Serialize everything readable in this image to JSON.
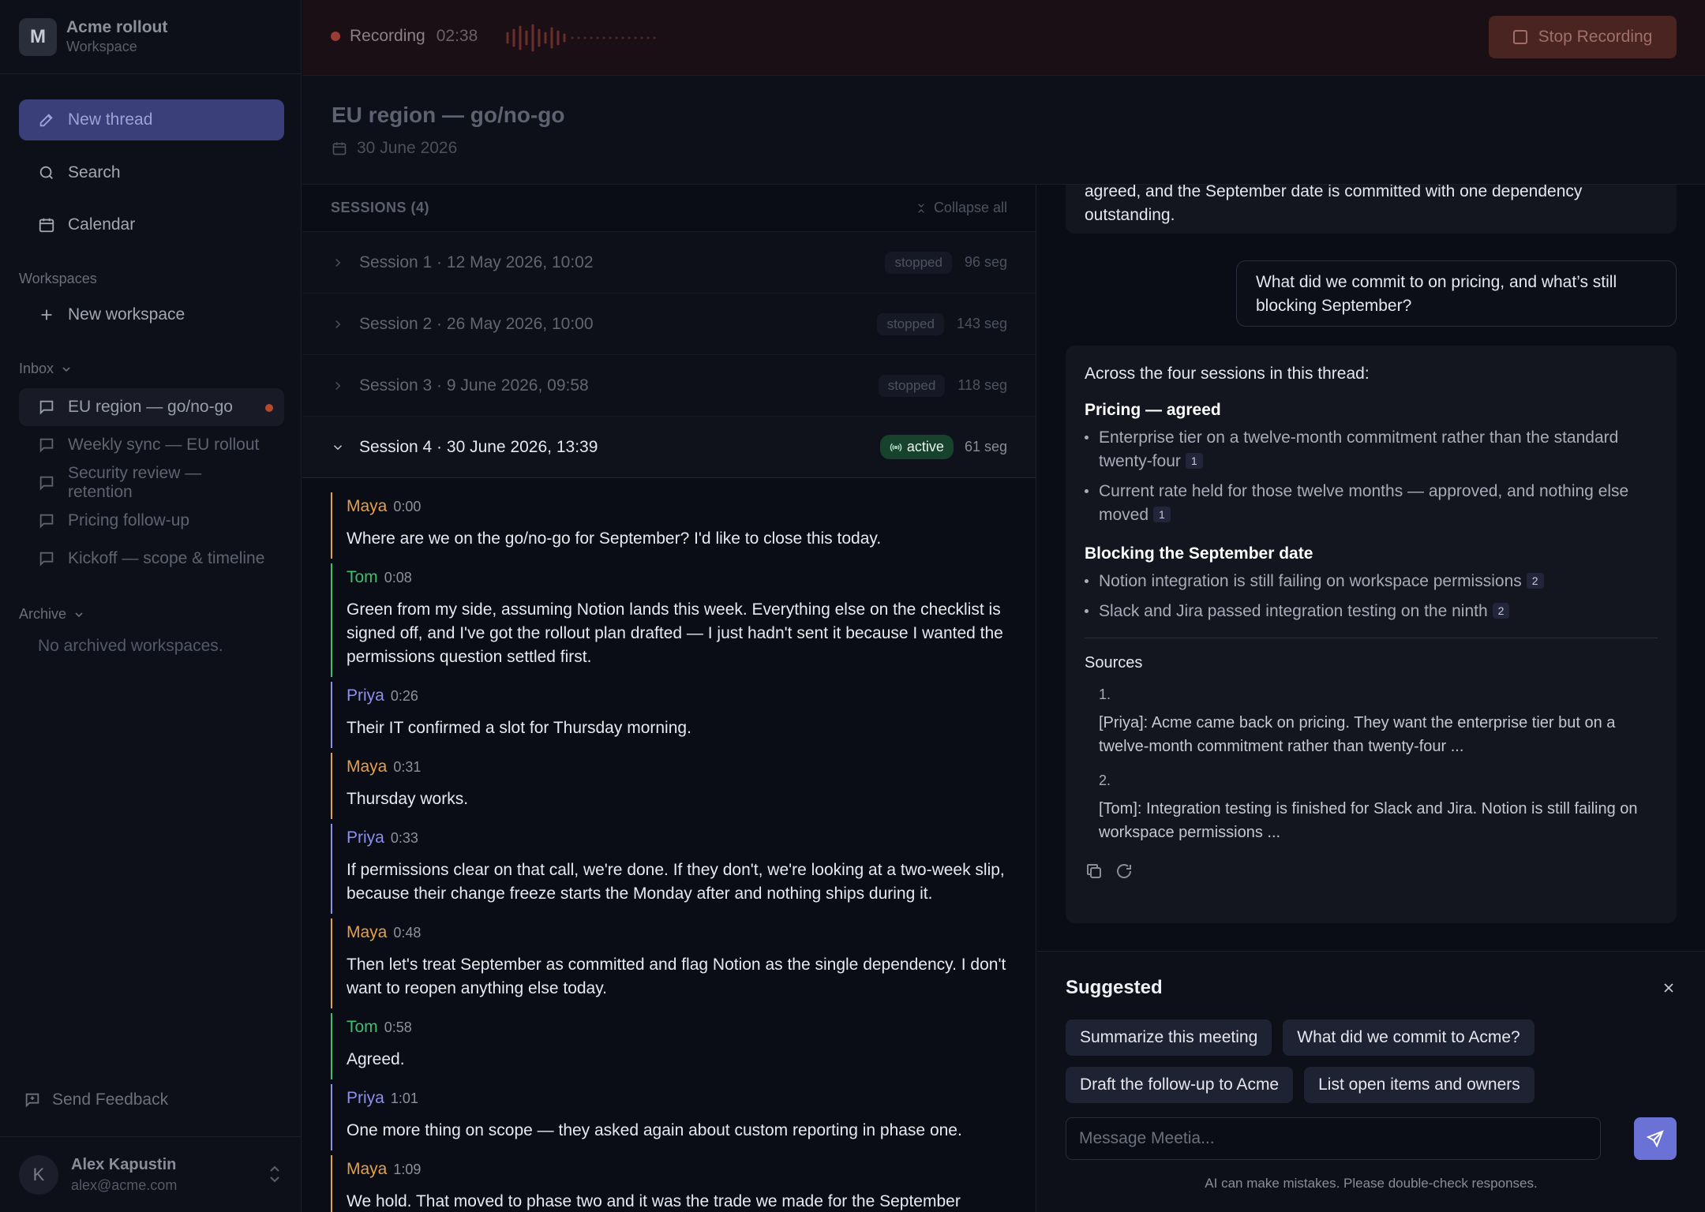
{
  "workspace": {
    "initial": "M",
    "name": "Acme rollout",
    "subtitle": "Workspace"
  },
  "sidebar": {
    "new_thread": "New thread",
    "search": "Search",
    "calendar": "Calendar",
    "workspaces_label": "Workspaces",
    "new_workspace": "New workspace",
    "inbox_label": "Inbox",
    "inbox": [
      {
        "label": "EU region — go/no-go",
        "active": true,
        "unread": true
      },
      {
        "label": "Weekly sync — EU rollout"
      },
      {
        "label": "Security review — retention"
      },
      {
        "label": "Pricing follow-up"
      },
      {
        "label": "Kickoff — scope & timeline"
      }
    ],
    "archive_label": "Archive",
    "archive_empty": "No archived workspaces.",
    "feedback": "Send Feedback",
    "user": {
      "initial": "K",
      "name": "Alex Kapustin",
      "email": "alex@acme.com"
    }
  },
  "recording": {
    "label": "Recording",
    "time": "02:38",
    "stop": "Stop Recording"
  },
  "thread": {
    "title": "EU region — go/no-go",
    "date": "30 June 2026"
  },
  "sessions": {
    "header": "SESSIONS (4)",
    "collapse": "Collapse all",
    "items": [
      {
        "label": "Session 1 · 12 May 2026, 10:02",
        "status": "stopped",
        "segments": "96 seg"
      },
      {
        "label": "Session 2 · 26 May 2026, 10:00",
        "status": "stopped",
        "segments": "143 seg"
      },
      {
        "label": "Session 3 · 9 June 2026, 09:58",
        "status": "stopped",
        "segments": "118 seg"
      },
      {
        "label": "Session 4 · 30 June 2026, 13:39",
        "status": "active",
        "segments": "61 seg"
      }
    ]
  },
  "transcript": [
    {
      "speaker": "Maya",
      "time": "0:00",
      "text": "Where are we on the go/no-go for September? I'd like to close this today."
    },
    {
      "speaker": "Tom",
      "time": "0:08",
      "text": "Green from my side, assuming Notion lands this week. Everything else on the checklist is signed off, and I've got the rollout plan drafted — I just hadn't sent it because I wanted the permissions question settled first."
    },
    {
      "speaker": "Priya",
      "time": "0:26",
      "text": "Their IT confirmed a slot for Thursday morning."
    },
    {
      "speaker": "Maya",
      "time": "0:31",
      "text": "Thursday works."
    },
    {
      "speaker": "Priya",
      "time": "0:33",
      "text": "If permissions clear on that call, we're done. If they don't, we're looking at a two-week slip, because their change freeze starts the Monday after and nothing ships during it."
    },
    {
      "speaker": "Maya",
      "time": "0:48",
      "text": "Then let's treat September as committed and flag Notion as the single dependency. I don't want to reopen anything else today."
    },
    {
      "speaker": "Tom",
      "time": "0:58",
      "text": "Agreed."
    },
    {
      "speaker": "Priya",
      "time": "1:01",
      "text": "One more thing on scope — they asked again about custom reporting in phase one."
    },
    {
      "speaker": "Maya",
      "time": "1:09",
      "text": "We hold. That moved to phase two and it was the trade we made for the September"
    }
  ],
  "speaker_colors": {
    "Maya": "#e3a04a",
    "Tom": "#3fbf6e",
    "Priya": "#8b8ff0"
  },
  "chat": {
    "prev_answer_tail": "agreed, and the September date is committed with one dependency outstanding.",
    "user_question": "What did we commit to on pricing, and what’s still blocking September?",
    "answer": {
      "intro": "Across the four sessions in this thread:",
      "sections": [
        {
          "heading": "Pricing — agreed",
          "bullets": [
            {
              "text": "Enterprise tier on a twelve-month commitment rather than the standard twenty-four",
              "cite": "1"
            },
            {
              "text": "Current rate held for those twelve months — approved, and nothing else moved",
              "cite": "1"
            }
          ]
        },
        {
          "heading": "Blocking the September date",
          "bullets": [
            {
              "text": "Notion integration is still failing on workspace permissions",
              "cite": "2"
            },
            {
              "text": "Slack and Jira passed integration testing on the ninth",
              "cite": "2"
            }
          ]
        }
      ],
      "sources_label": "Sources",
      "sources": [
        {
          "num": "1.",
          "text": "[Priya]: Acme came back on pricing. They want the enterprise tier but on a twelve-month commitment rather than twenty-four ..."
        },
        {
          "num": "2.",
          "text": "[Tom]: Integration testing is finished for Slack and Jira. Notion is still failing on workspace permissions ..."
        }
      ]
    }
  },
  "suggested": {
    "title": "Suggested",
    "chips": [
      "Summarize this meeting",
      "What did we commit to Acme?",
      "Draft the follow-up to Acme",
      "List open items and owners"
    ],
    "placeholder": "Message Meetia...",
    "disclaimer": "AI can make mistakes. Please double-check responses."
  }
}
